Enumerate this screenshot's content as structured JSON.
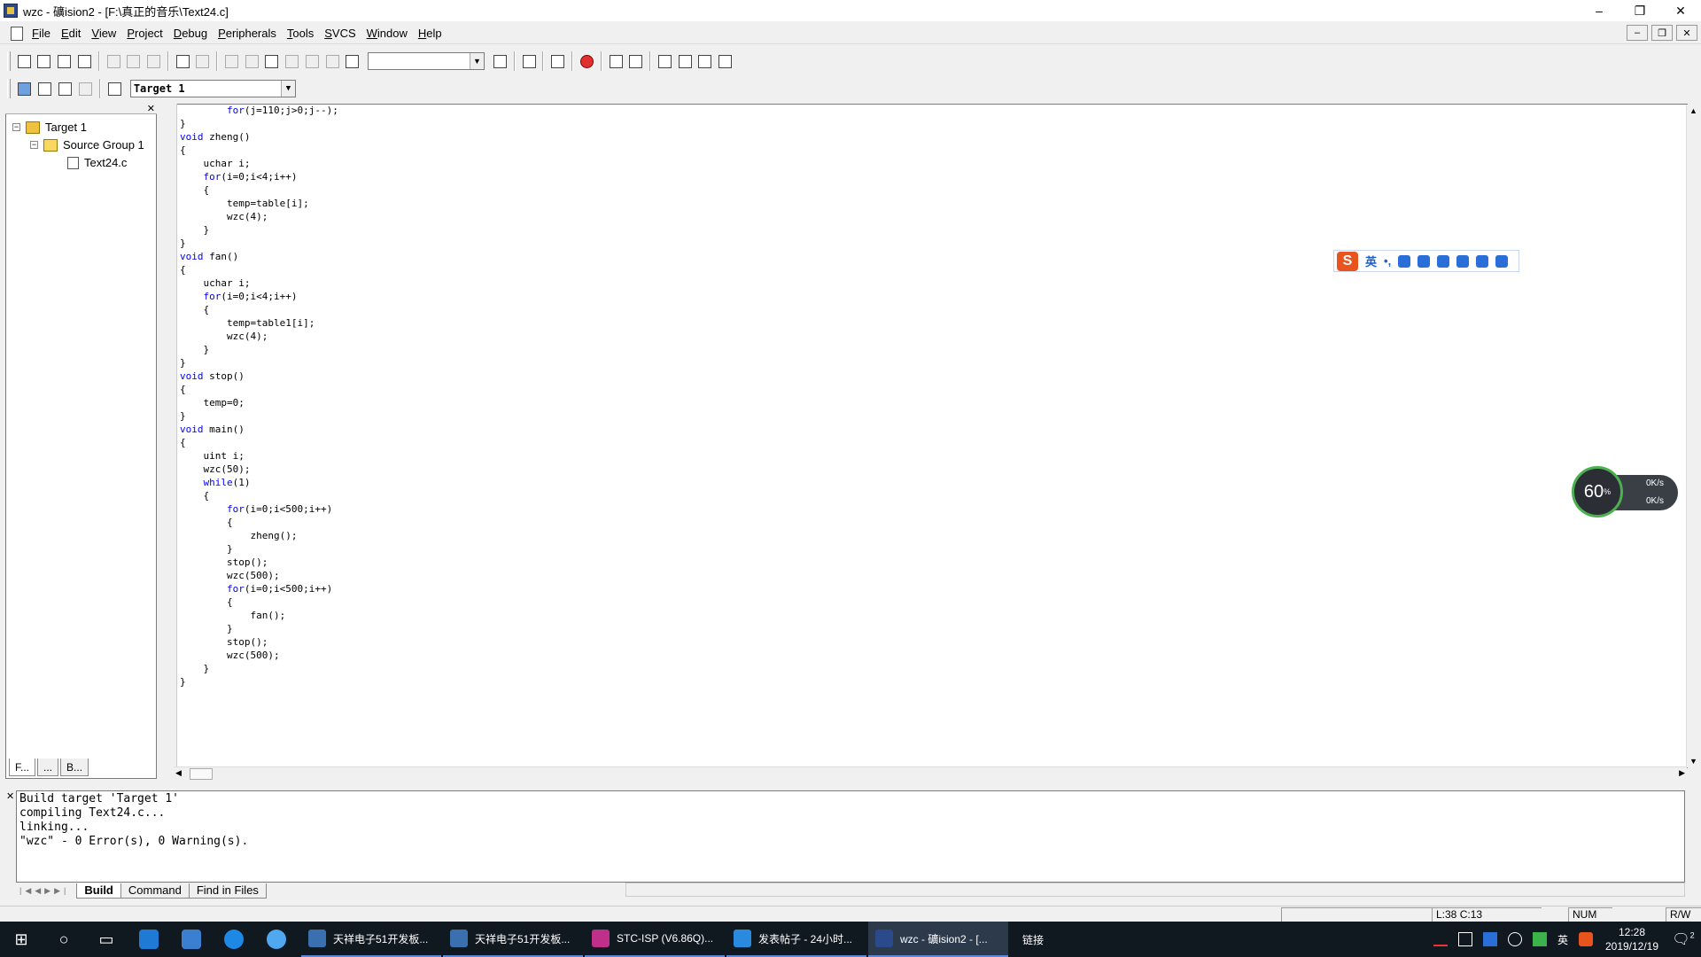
{
  "window": {
    "title": "wzc  - 礦ision2 - [F:\\真正的音乐\\Text24.c]",
    "min": "–",
    "max": "❐",
    "close": "✕"
  },
  "menu": [
    "File",
    "Edit",
    "View",
    "Project",
    "Debug",
    "Peripherals",
    "Tools",
    "SVCS",
    "Window",
    "Help"
  ],
  "mdi_controls": [
    "–",
    "❐",
    "✕"
  ],
  "toolbar2": {
    "target_value": "Target 1"
  },
  "project": {
    "target": "Target 1",
    "group": "Source Group 1",
    "file": "Text24.c",
    "tabs": [
      "F...",
      "...",
      "B..."
    ]
  },
  "editor": {
    "lines": [
      "        for(j=110;j>0;j--);",
      "}",
      "void zheng()",
      "{",
      "    uchar i;",
      "    for(i=0;i<4;i++)",
      "    {",
      "        temp=table[i];",
      "        wzc(4);",
      "    }",
      "}",
      "void fan()",
      "{",
      "    uchar i;",
      "    for(i=0;i<4;i++)",
      "    {",
      "        temp=table1[i];",
      "        wzc(4);",
      "    }",
      "}",
      "void stop()",
      "{",
      "    temp=0;",
      "}",
      "void main()",
      "{",
      "    uint i;",
      "    wzc(50);",
      "    while(1)",
      "    {",
      "        for(i=0;i<500;i++)",
      "        {",
      "            zheng();",
      "        }",
      "        stop();",
      "        wzc(500);",
      "        for(i=0;i<500;i++)",
      "        {",
      "            fan();",
      "        }",
      "        stop();",
      "        wzc(500);",
      "    }",
      "}"
    ]
  },
  "ime": {
    "logo": "S",
    "lang": "英",
    "punct": "•,"
  },
  "net": {
    "percent": "60",
    "unit": "%",
    "up": "0K/s",
    "down": "0K/s"
  },
  "output": {
    "lines": [
      "Build target 'Target 1'",
      "compiling Text24.c...",
      "linking...",
      "\"wzc\" - 0 Error(s), 0 Warning(s)."
    ],
    "tabs": [
      "Build",
      "Command",
      "Find in Files"
    ]
  },
  "status": {
    "position": "L:38 C:13",
    "num": "NUM",
    "rw": "R/W"
  },
  "taskbar": {
    "tasks": [
      {
        "label": "天祥电子51开发板...",
        "color": "#3a6fb0"
      },
      {
        "label": "天祥电子51开发板...",
        "color": "#3a6fb0"
      },
      {
        "label": "STC-ISP (V6.86Q)...",
        "color": "#c0308a"
      },
      {
        "label": "发表帖子 - 24小时...",
        "color": "#2a8ae0"
      },
      {
        "label": "wzc  - 礦ision2 - [...",
        "color": "#2b4a8b"
      }
    ],
    "link": "链接",
    "ime": "英",
    "time": "12:28",
    "date": "2019/12/19",
    "notifications": "2"
  }
}
